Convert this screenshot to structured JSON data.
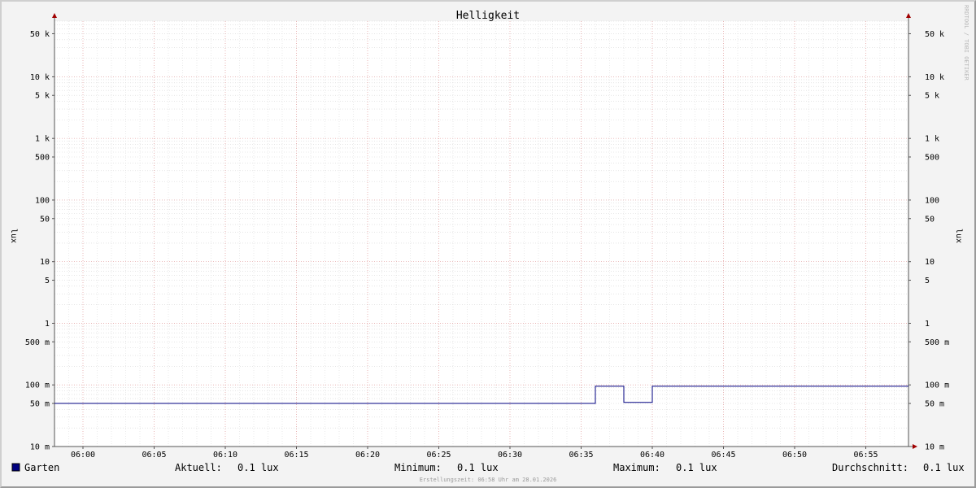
{
  "chart_data": {
    "type": "line",
    "title": "Helligkeit",
    "ylabel": "lux",
    "yscale": "log",
    "ylim": [
      0.01,
      80000
    ],
    "y_major_ticks": [
      {
        "value": 50000,
        "label": "50 k"
      },
      {
        "value": 10000,
        "label": "10 k"
      },
      {
        "value": 5000,
        "label": "5 k"
      },
      {
        "value": 1000,
        "label": "1 k"
      },
      {
        "value": 500,
        "label": "500"
      },
      {
        "value": 100,
        "label": "100"
      },
      {
        "value": 50,
        "label": "50"
      },
      {
        "value": 10,
        "label": "10"
      },
      {
        "value": 5,
        "label": "5"
      },
      {
        "value": 1,
        "label": "1"
      },
      {
        "value": 0.5,
        "label": "500 m"
      },
      {
        "value": 0.1,
        "label": "100 m"
      },
      {
        "value": 0.05,
        "label": "50 m"
      },
      {
        "value": 0.01,
        "label": "10 m"
      }
    ],
    "xlim": [
      "05:58",
      "06:58"
    ],
    "x_ticks": [
      "06:00",
      "06:05",
      "06:10",
      "06:15",
      "06:20",
      "06:25",
      "06:30",
      "06:35",
      "06:40",
      "06:45",
      "06:50",
      "06:55"
    ],
    "grid": true,
    "series": [
      {
        "name": "Garten",
        "color": "#000080",
        "points": [
          {
            "t": "05:58",
            "v": 0.05
          },
          {
            "t": "06:36",
            "v": 0.05
          },
          {
            "t": "06:36",
            "v": 0.095
          },
          {
            "t": "06:38",
            "v": 0.095
          },
          {
            "t": "06:38",
            "v": 0.052
          },
          {
            "t": "06:40",
            "v": 0.052
          },
          {
            "t": "06:40",
            "v": 0.095
          },
          {
            "t": "06:58",
            "v": 0.095
          }
        ]
      }
    ]
  },
  "legend": {
    "series_name": "Garten",
    "swatch_color": "#000080",
    "current_label": "Aktuell:",
    "current_value": "0.1 lux",
    "min_label": "Minimum:",
    "min_value": "0.1 lux",
    "max_label": "Maximum:",
    "max_value": "0.1 lux",
    "avg_label": "Durchschnitt:",
    "avg_value": "0.1 lux"
  },
  "watermark": "RRDTOOL / TOBI OETIKER",
  "footer_text": "Erstellungszeit: 06:58 Uhr am 28.01.2026"
}
